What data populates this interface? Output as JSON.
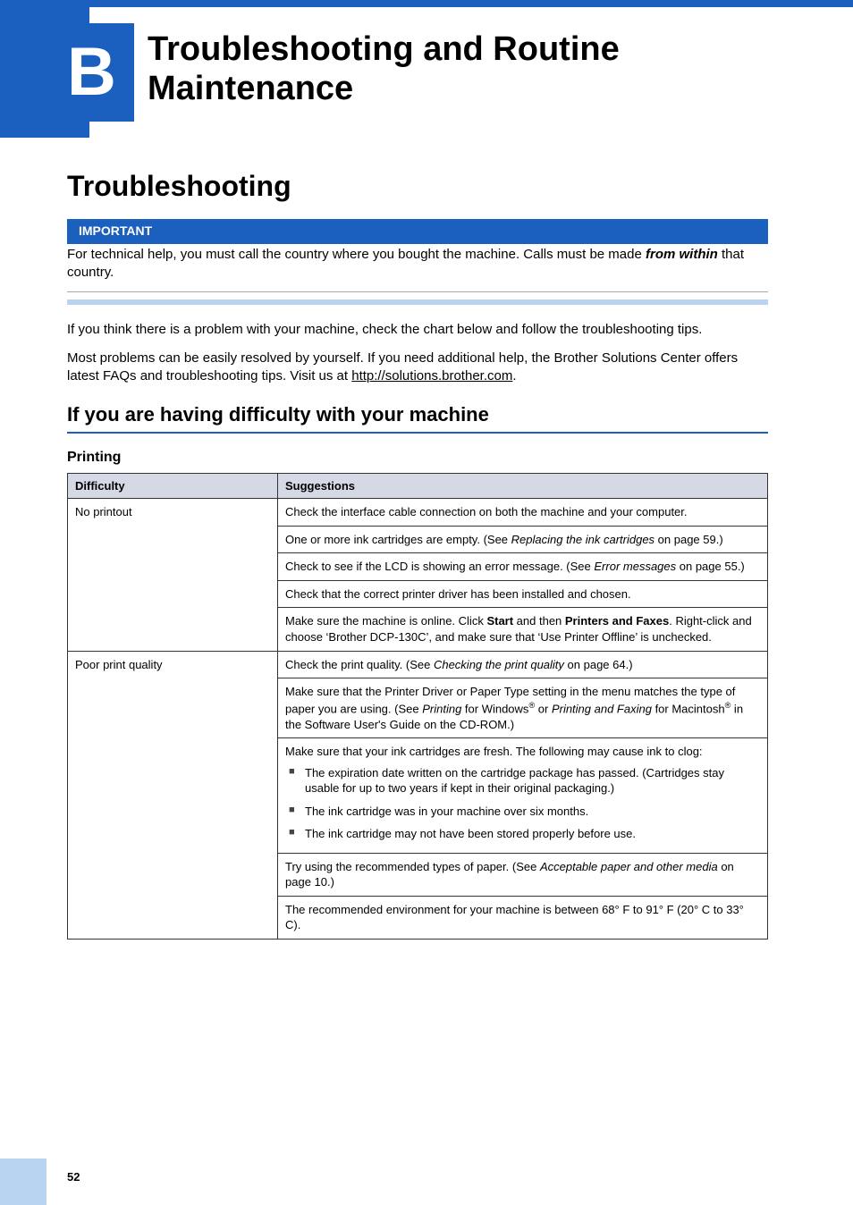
{
  "chapter": {
    "letter": "B",
    "title": "Troubleshooting and Routine Maintenance"
  },
  "section_title": "Troubleshooting",
  "important": {
    "label": "IMPORTANT",
    "text_pre": "For technical help, you must call the country where you bought the machine. Calls must be made ",
    "text_em": "from within",
    "text_post": " that country."
  },
  "intro1": "If you think there is a problem with your machine, check the chart below and follow the troubleshooting tips.",
  "intro2_pre": "Most problems can be easily resolved by yourself. If you need additional help, the Brother Solutions Center offers latest FAQs and troubleshooting tips. Visit us at ",
  "intro2_link": "http://solutions.brother.com",
  "intro2_post": ".",
  "subheading": "If you are having difficulty with your machine",
  "table_title": "Printing",
  "headers": {
    "difficulty": "Difficulty",
    "suggestions": "Suggestions"
  },
  "rows": [
    {
      "difficulty": "No printout",
      "cells": [
        {
          "t": "plain",
          "v": "Check the interface cable connection on both the machine and your computer."
        },
        {
          "t": "xref",
          "pre": "One or more ink cartridges are empty. (See ",
          "em": "Replacing the ink cartridges",
          "post": " on page 59.)"
        },
        {
          "t": "xref",
          "pre": "Check to see if the LCD is showing an error message. (See ",
          "em": "Error messages",
          "post": " on page 55.)"
        },
        {
          "t": "plain",
          "v": "Check that the correct printer driver has been installed and chosen."
        },
        {
          "t": "rich_online",
          "p1": "Make sure the machine is online. Click ",
          "b1": "Start",
          "p2": " and then ",
          "b2": "Printers and Faxes",
          "p3": ". Right-click and choose ‘Brother DCP-130C’, and make sure that ‘Use Printer Offline’ is unchecked."
        }
      ]
    },
    {
      "difficulty": "Poor print quality",
      "cells": [
        {
          "t": "xref",
          "pre": "Check the print quality. (See ",
          "em": "Checking the print quality",
          "post": " on page 64.)"
        },
        {
          "t": "driver",
          "p1": "Make sure that the Printer Driver or Paper Type setting in the menu matches the type of paper you are using. (See ",
          "e1": "Printing",
          "p2": " for Windows",
          "sup1": "®",
          "p3": " or ",
          "e2": "Printing and Faxing",
          "p4": " for Macintosh",
          "sup2": "®",
          "p5": " in the Software User's Guide on the CD-ROM.)"
        },
        {
          "t": "bullets",
          "intro": "Make sure that your ink cartridges are fresh. The following may cause ink to clog:",
          "items": [
            "The expiration date written on the cartridge package has passed. (Cartridges stay usable for up to two years if kept in their original packaging.)",
            "The ink cartridge was in your machine over six months.",
            "The ink cartridge may not have been stored properly before use."
          ]
        },
        {
          "t": "xref",
          "pre": "Try using the recommended types of paper. (See ",
          "em": "Acceptable paper and other media",
          "post": " on page 10.)"
        },
        {
          "t": "plain",
          "v": "The recommended environment for your machine is between 68° F to 91° F (20° C to 33° C)."
        }
      ]
    }
  ],
  "page_number": "52"
}
